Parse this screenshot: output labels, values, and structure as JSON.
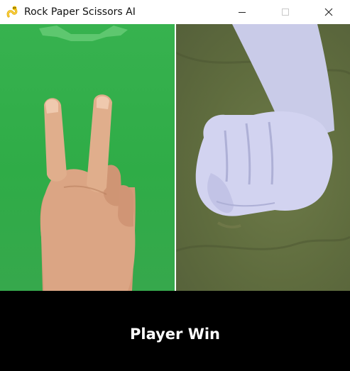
{
  "window": {
    "title": "Rock Paper Scissors AI",
    "app_icon": "pygame-snake-icon",
    "controls": [
      "minimize-icon",
      "maximize-icon",
      "close-icon"
    ]
  },
  "game": {
    "player_move": "scissors",
    "ai_move": "rock",
    "result_text": "Player Win"
  },
  "colors": {
    "left_background": "#32ae4a",
    "right_background": "#5f6c3e",
    "footer_background": "#000000",
    "result_text": "#ffffff"
  }
}
